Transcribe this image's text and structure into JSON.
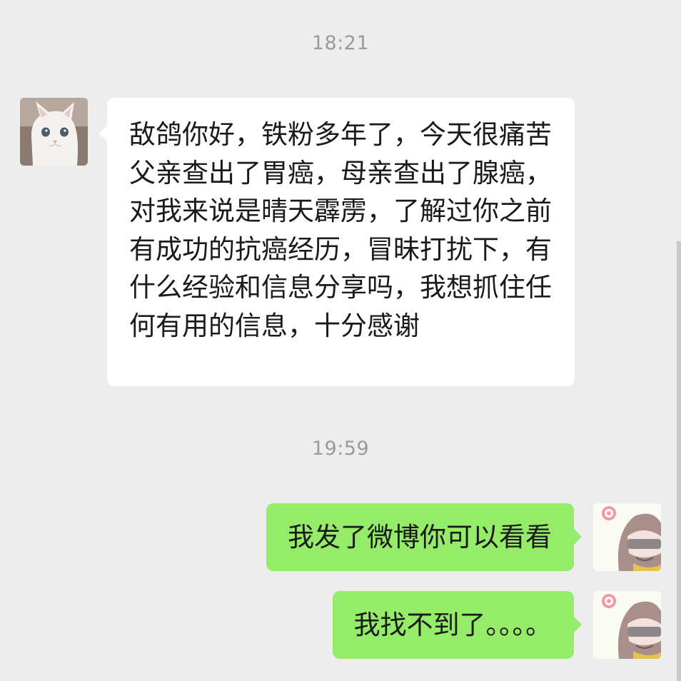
{
  "messages": [
    {
      "type": "time",
      "text": "18:21"
    },
    {
      "type": "incoming",
      "avatar": "white-cat-avatar",
      "text": "敌鸽你好，铁粉多年了，今天很痛苦父亲查出了胃癌，母亲查出了腺癌，对我来说是晴天霹雳，了解过你之前有成功的抗癌经历，冒昧打扰下，有什么经验和信息分享吗，我想抓住任何有用的信息，十分感谢"
    },
    {
      "type": "time",
      "text": "19:59"
    },
    {
      "type": "outgoing",
      "avatar": "anime-girl-avatar",
      "text": "我发了微博你可以看看"
    },
    {
      "type": "outgoing",
      "avatar": "anime-girl-avatar",
      "text": "我找不到了。。。。"
    }
  ],
  "colors": {
    "background": "#ededed",
    "incoming_bubble": "#ffffff",
    "outgoing_bubble": "#95ec69",
    "timestamp_text": "#9a9a9a",
    "message_text": "#1a1a1a"
  }
}
